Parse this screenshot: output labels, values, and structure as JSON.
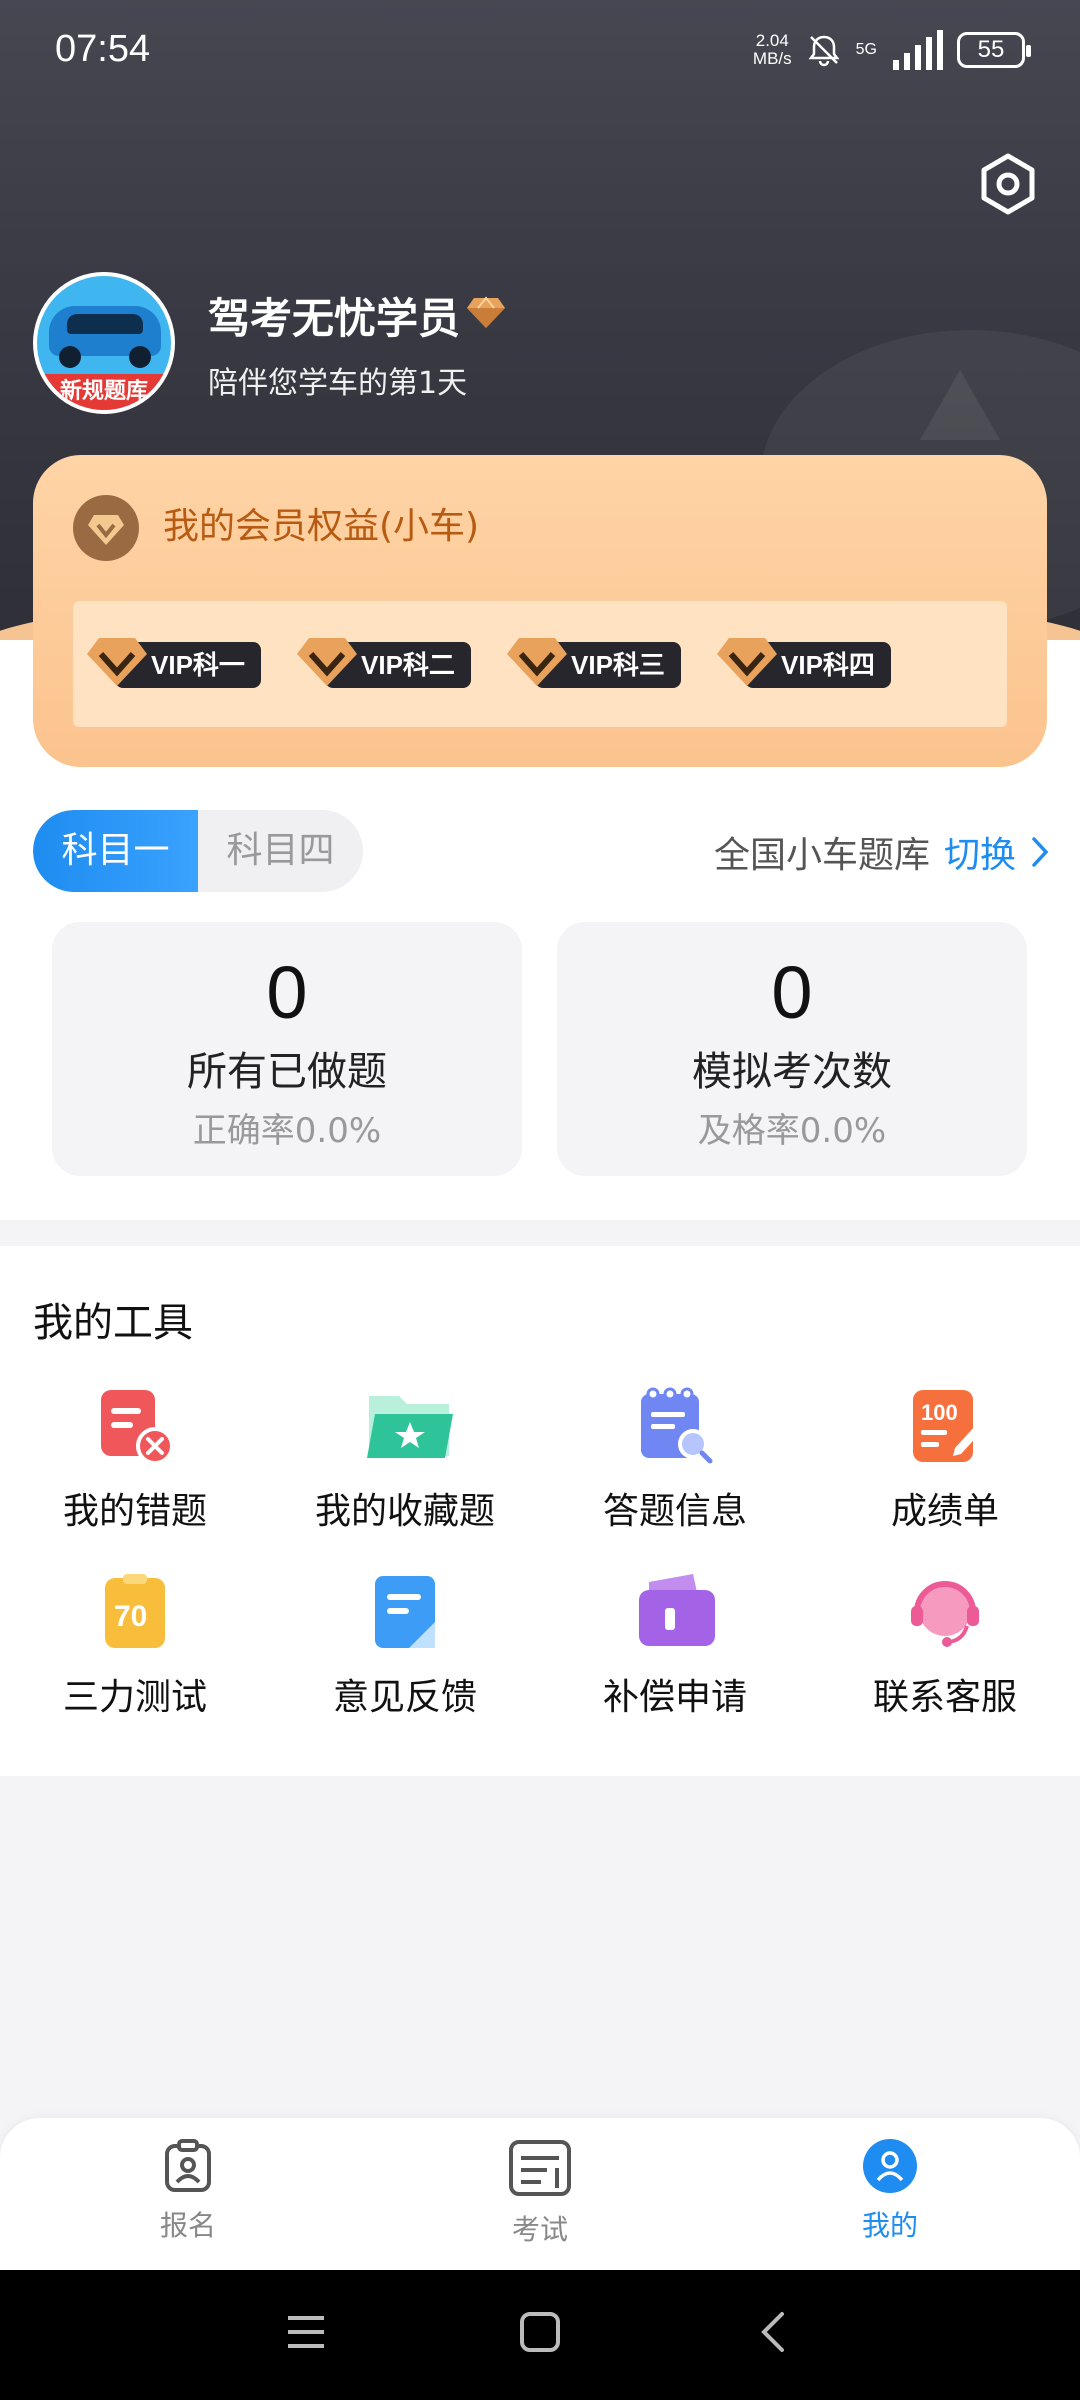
{
  "status_bar": {
    "time": "07:54",
    "net_speed_value": "2.04",
    "net_speed_unit": "MB/s",
    "network": "5G",
    "battery": "55"
  },
  "profile": {
    "avatar_ribbon": "新规题库",
    "name": "驾考无忧学员",
    "subtitle": "陪伴您学车的第1天"
  },
  "membership": {
    "title": "我的会员权益(小车)",
    "badges": [
      "VIP科一",
      "VIP科二",
      "VIP科三",
      "VIP科四"
    ]
  },
  "subject_tabs": {
    "items": [
      "科目一",
      "科目四"
    ],
    "active_index": 0
  },
  "question_bank": {
    "label": "全国小车题库",
    "switch_label": "切换"
  },
  "stats": [
    {
      "value": "0",
      "label": "所有已做题",
      "rate": "正确率0.0%"
    },
    {
      "value": "0",
      "label": "模拟考次数",
      "rate": "及格率0.0%"
    }
  ],
  "tools": {
    "title": "我的工具",
    "items": [
      {
        "label": "我的错题",
        "icon": "wrong-questions-icon"
      },
      {
        "label": "我的收藏题",
        "icon": "favorites-folder-icon"
      },
      {
        "label": "答题信息",
        "icon": "answer-info-icon"
      },
      {
        "label": "成绩单",
        "icon": "score-sheet-icon"
      },
      {
        "label": "三力测试",
        "icon": "ability-test-icon",
        "badge": "70"
      },
      {
        "label": "意见反馈",
        "icon": "feedback-icon"
      },
      {
        "label": "补偿申请",
        "icon": "compensation-wallet-icon"
      },
      {
        "label": "联系客服",
        "icon": "customer-service-icon"
      }
    ],
    "score_icon_text": "100"
  },
  "bottom_nav": {
    "items": [
      "报名",
      "考试",
      "我的"
    ],
    "active_index": 2
  },
  "colors": {
    "accent": "#1e8cf0",
    "member_text": "#b85b12",
    "member_card": "#fbc38e",
    "header_bg": "#3a3a44"
  }
}
